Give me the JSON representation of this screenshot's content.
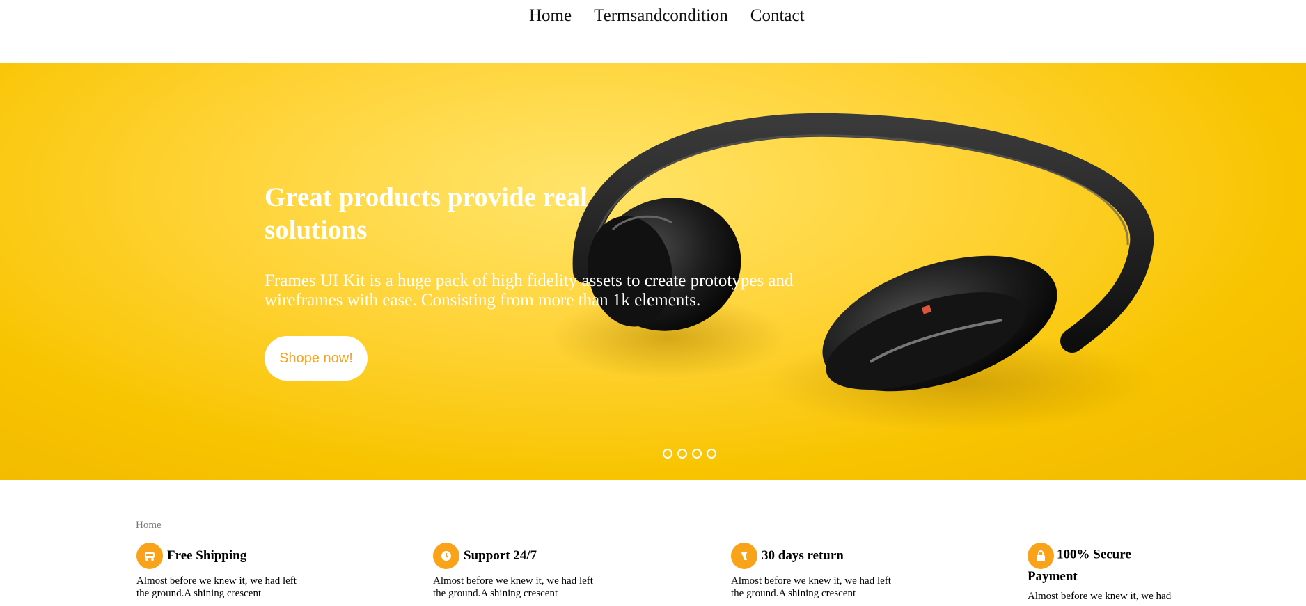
{
  "nav": {
    "items": [
      {
        "label": "Home"
      },
      {
        "label": "Termsandcondition"
      },
      {
        "label": "Contact"
      }
    ]
  },
  "hero": {
    "title": "Great products provide real solutions",
    "subtitle": "Frames UI Kit is a huge pack of high fidelity assets to create prototypes and wireframes with ease. Consisting from more than 1k elements.",
    "button_label": "Shope now!",
    "slide_count": 4,
    "colors": {
      "background": "#fdd23a",
      "button_text": "#f7a21b"
    }
  },
  "breadcrumb": "Home",
  "features": [
    {
      "icon": "truck-icon",
      "title": "Free Shipping",
      "text": "Almost before we knew it, we had left the ground.A shining crescent"
    },
    {
      "icon": "support-icon",
      "title": "Support 24/7",
      "text": "Almost before we knew it, we had left the ground.A shining crescent"
    },
    {
      "icon": "return-icon",
      "title": "30 days return",
      "text": "Almost before we knew it, we had left the ground.A shining crescent"
    },
    {
      "icon": "lock-icon",
      "title": "100% Secure Payment",
      "text": "Almost before we knew it, we had"
    }
  ],
  "accent_color": "#f8a319"
}
